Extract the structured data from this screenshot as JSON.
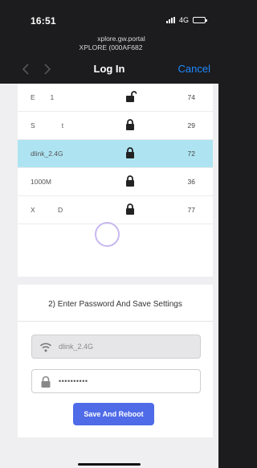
{
  "status_bar": {
    "time": "16:51",
    "network": "4G"
  },
  "browser": {
    "url_line1": "xplore.gw.portal",
    "url_line2": "XPLORE (000AF682",
    "title": "Log In",
    "cancel_label": "Cancel",
    "back_icon": "chevron-left-icon",
    "forward_icon": "chevron-right-icon"
  },
  "networks": [
    {
      "ssid": "E        1",
      "locked": false,
      "signal": "74",
      "selected": false
    },
    {
      "ssid": "S              t",
      "locked": true,
      "signal": "29",
      "selected": false
    },
    {
      "ssid": "dlink_2.4G",
      "locked": true,
      "signal": "72",
      "selected": true
    },
    {
      "ssid": "1000M",
      "locked": true,
      "signal": "36",
      "selected": false
    },
    {
      "ssid": "X            D",
      "locked": true,
      "signal": "77",
      "selected": false
    }
  ],
  "settings": {
    "title": "2) Enter Password And Save Settings",
    "ssid_value": "dlink_2.4G",
    "password_value": "••••••••••",
    "save_label": "Save And Reboot"
  },
  "colors": {
    "accent": "#4f6be8",
    "selected_row": "#aee4f2",
    "link": "#1e88ff"
  }
}
